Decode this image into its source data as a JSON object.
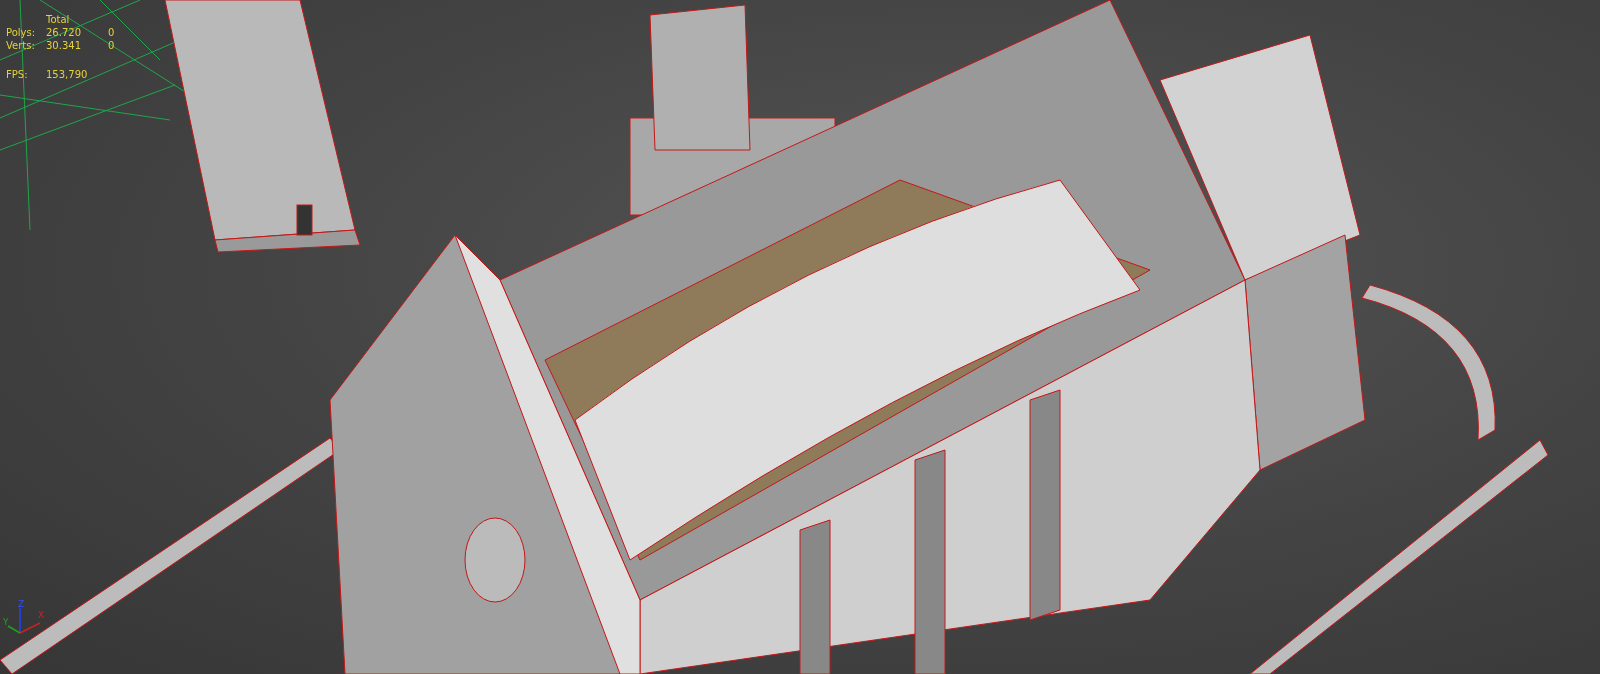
{
  "viewport": {
    "stats": {
      "header": "Total",
      "rows": [
        {
          "label": "Polys:",
          "total": "26.720",
          "selection": "0"
        },
        {
          "label": "Verts:",
          "total": "30.341",
          "selection": "0"
        }
      ],
      "fps": {
        "label": "FPS:",
        "value": "153,790"
      }
    },
    "axis_gizmo": {
      "x": "X",
      "y": "Y",
      "z": "Z"
    }
  }
}
